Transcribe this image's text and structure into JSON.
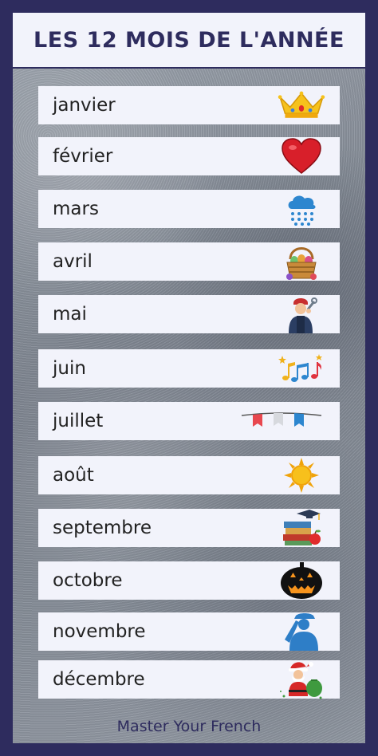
{
  "title": "LES 12 MOIS DE L'ANNÉE",
  "months": [
    {
      "label": "janvier",
      "icon": "crown-icon"
    },
    {
      "label": "février",
      "icon": "heart-icon"
    },
    {
      "label": "mars",
      "icon": "rain-cloud-icon"
    },
    {
      "label": "avril",
      "icon": "easter-basket-icon"
    },
    {
      "label": "mai",
      "icon": "worker-icon"
    },
    {
      "label": "juin",
      "icon": "music-notes-icon"
    },
    {
      "label": "juillet",
      "icon": "bunting-flags-icon"
    },
    {
      "label": "août",
      "icon": "sun-icon"
    },
    {
      "label": "septembre",
      "icon": "school-books-icon"
    },
    {
      "label": "octobre",
      "icon": "pumpkin-icon"
    },
    {
      "label": "novembre",
      "icon": "saluting-soldier-icon"
    },
    {
      "label": "décembre",
      "icon": "santa-icon"
    }
  ],
  "footer": "Master Your French",
  "colors": {
    "frame": "#2e2c5e",
    "row": "#f2f3fb",
    "panel": "#8a919b"
  }
}
